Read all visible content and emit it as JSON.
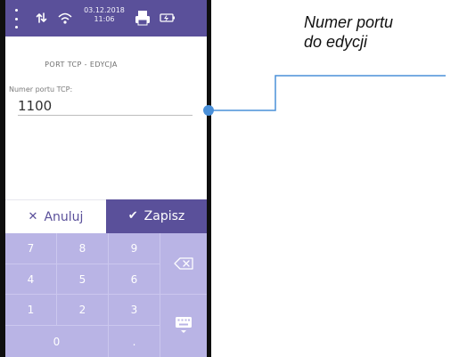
{
  "status_bar": {
    "date": "03.12.2018",
    "time": "11:06"
  },
  "screen": {
    "title": "PORT TCP - EDYCJA",
    "field_label": "Numer portu TCP:",
    "field_value": "1100"
  },
  "actions": {
    "cancel_label": "Anuluj",
    "save_label": "Zapisz",
    "cancel_icon": "close-icon",
    "save_icon": "check-icon"
  },
  "keypad": {
    "keys": [
      "7",
      "8",
      "9",
      "4",
      "5",
      "6",
      "1",
      "2",
      "3",
      "0",
      "."
    ],
    "backspace_icon": "backspace-icon",
    "keyboard_icon": "keyboard-hide-icon"
  },
  "annotation": {
    "line1": "Numer portu",
    "line2": "do edycji"
  },
  "colors": {
    "accent": "#5a509a",
    "keypad_bg": "#b9b4e5",
    "callout": "#4a90d9"
  }
}
